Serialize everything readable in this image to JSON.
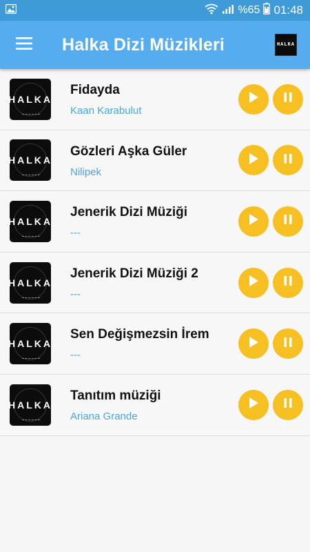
{
  "status_bar": {
    "battery_text": "%65",
    "time": "01:48",
    "icons": [
      "image-icon",
      "wifi-icon",
      "signal-icon",
      "battery-icon"
    ]
  },
  "app_bar": {
    "title": "Halka Dizi Müzikleri",
    "menu_icon": "menu-icon",
    "logo_text": "HALKA"
  },
  "songs": [
    {
      "title": "Fidayda",
      "artist": "Kaan Karabulut",
      "thumb": "HALKA"
    },
    {
      "title": "Gözleri Aşka Güler",
      "artist": "Nilipek",
      "thumb": "HALKA"
    },
    {
      "title": "Jenerik Dizi Müziği",
      "artist": "---",
      "thumb": "HALKA"
    },
    {
      "title": "Jenerik Dizi Müziği 2",
      "artist": "---",
      "thumb": "HALKA"
    },
    {
      "title": "Sen Değişmezsin İrem",
      "artist": "---",
      "thumb": "HALKA"
    },
    {
      "title": "Tanıtım müziği",
      "artist": "Ariana Grande",
      "thumb": "HALKA"
    }
  ],
  "colors": {
    "status_bar": "#3f9bd8",
    "app_bar": "#55adf0",
    "button": "#f6bf22",
    "artist": "#4aa6da"
  }
}
